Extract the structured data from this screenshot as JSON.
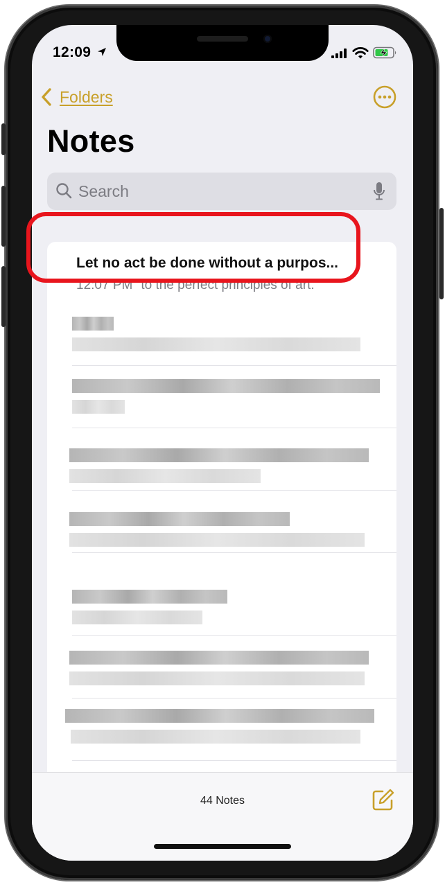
{
  "status_bar": {
    "time": "12:09",
    "icons": [
      "location-arrow-icon",
      "cellular-signal-icon",
      "wifi-icon",
      "battery-charging-icon"
    ]
  },
  "nav": {
    "back_label": "Folders",
    "more_icon": "ellipsis-circle-icon"
  },
  "page_title": "Notes",
  "search": {
    "placeholder": "Search"
  },
  "notes": {
    "first": {
      "title": "Let no act be done without a purpos...",
      "time": "12:07 PM",
      "preview": "to the perfect principles of art."
    }
  },
  "toolbar": {
    "note_count": "44 Notes",
    "compose_icon": "compose-icon"
  },
  "colors": {
    "accent": "#c8a02a",
    "highlight": "#e8151d",
    "background": "#efeff4"
  }
}
